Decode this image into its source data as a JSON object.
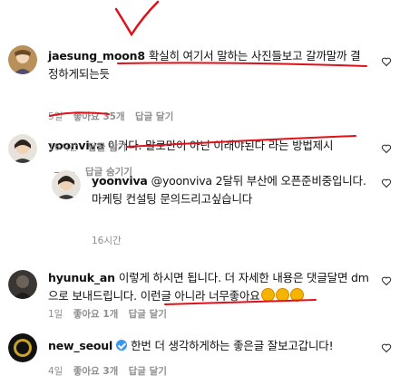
{
  "comments": [
    {
      "username": "jaesung_moon8",
      "text": "확실히 여기서 말하는 사진들보고 갈까말까 결정하게되는듯",
      "time": "5일",
      "likes": "좋아요 35개",
      "reply_label": "답글 달기"
    },
    {
      "username": "yoonviva",
      "text": "이거다. 말로만이 아닌 이래야된다 라는 방법제시",
      "time": "16시간",
      "reply_label": "답글 달기",
      "hide_replies_label": "답글 숨기기"
    },
    {
      "username": "yoonviva",
      "text": "@yoonviva 2달뒤 부산에 오픈준비중입니다. 마케팅 컨설팅 문의드리고싶습니다",
      "time": "16시간"
    },
    {
      "username": "hyunuk_an",
      "text": "이렇게 하시면 됩니다. 더 자세한 내용은 댓글달면 dm으로 보내드립니다. 이런글 아니라 너무좋아요",
      "time": "1일",
      "likes": "좋아요 1개",
      "reply_label": "답글 달기"
    },
    {
      "username": "new_seoul",
      "text": "한번 더 생각하게하는 좋은글 잘보고갑니다!",
      "time": "4일",
      "likes": "좋아요 3개",
      "reply_label": "답글 달기"
    }
  ],
  "colors": {
    "annotation_red": "#e0101a",
    "meta_gray": "#8e8e8e",
    "verified_blue": "#3897f0"
  },
  "icons": [
    "heart-icon",
    "verified-badge-icon",
    "clap-emoji-icon"
  ]
}
